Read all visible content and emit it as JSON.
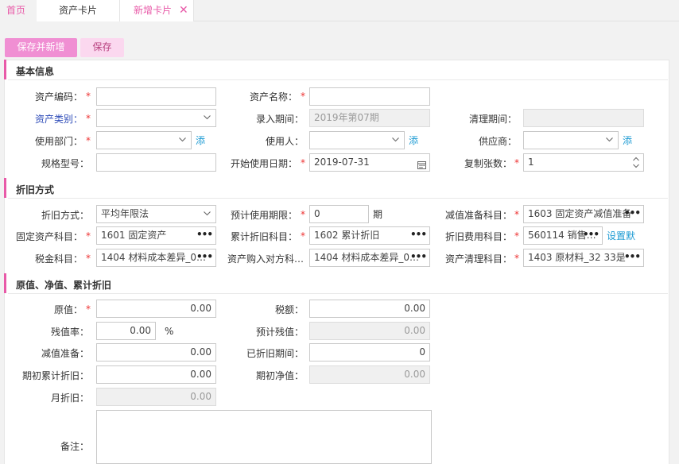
{
  "tabs": {
    "home": "首页",
    "asset_card": "资产卡片",
    "new_card": "新增卡片"
  },
  "toolbar": {
    "save_new_label": "保存并新增",
    "save_label": "保存"
  },
  "sections": {
    "basic": "基本信息",
    "depreciation": "折旧方式",
    "value": "原值、净值、累计折旧"
  },
  "basic": {
    "asset_code_label": "资产编码：",
    "asset_code_value": "",
    "asset_name_label": "资产名称：",
    "asset_name_value": "",
    "asset_category_label": "资产类别：",
    "asset_category_value": "",
    "entry_period_label": "录入期间：",
    "entry_period_value": "2019年第07期",
    "cleanup_period_label": "清理期间：",
    "cleanup_period_value": "",
    "department_label": "使用部门：",
    "department_value": "",
    "department_add": "添",
    "user_label": "使用人：",
    "user_value": "",
    "user_add": "添",
    "supplier_label": "供应商：",
    "supplier_value": "",
    "supplier_add": "添",
    "spec_label": "规格型号：",
    "spec_value": "",
    "start_date_label": "开始使用日期：",
    "start_date_value": "2019-07-31",
    "copy_count_label": "复制张数：",
    "copy_count_value": "1"
  },
  "depreciation": {
    "method_label": "折旧方式：",
    "method_value": "平均年限法",
    "life_label": "预计使用期限：",
    "life_value": "0",
    "life_unit": "期",
    "impairment_account_label": "减值准备科目：",
    "impairment_account_value": "1603 固定资产减值准备",
    "fixed_asset_account_label": "固定资产科目：",
    "fixed_asset_account_value": "1601 固定资产",
    "accum_dep_account_label": "累计折旧科目：",
    "accum_dep_account_value": "1602 累计折旧",
    "dep_expense_account_label": "折旧费用科目：",
    "dep_expense_account_value": "560114 销售…",
    "set_default": "设置默",
    "tax_account_label": "税金科目：",
    "tax_account_value": "1404 材料成本差异_0…",
    "purchase_offset_label": "资产购入对方科…",
    "purchase_offset_value": "1404 材料成本差异_0…",
    "disposal_account_label": "资产清理科目：",
    "disposal_account_value": "1403 原材料_32 33是"
  },
  "value": {
    "original_label": "原值：",
    "original_value": "0.00",
    "tax_label": "税额：",
    "tax_value": "0.00",
    "residual_rate_label": "残值率：",
    "residual_rate_value": "0.00",
    "residual_rate_unit": "%",
    "est_residual_label": "预计残值：",
    "est_residual_value": "0.00",
    "impairment_label": "减值准备：",
    "impairment_value": "0.00",
    "dep_periods_label": "已折旧期间：",
    "dep_periods_value": "0",
    "opening_accum_label": "期初累计折旧：",
    "opening_accum_value": "0.00",
    "opening_net_label": "期初净值：",
    "opening_net_value": "0.00",
    "monthly_dep_label": "月折旧：",
    "monthly_dep_value": "0.00",
    "remark_label": "备注："
  },
  "required_mark": "*",
  "colors": {
    "accent": "#e85aa8",
    "primary_button": "#f08fd3",
    "secondary_button": "#fbd8ef",
    "required": "#ee3333",
    "link": "#1d9bd3",
    "category_label": "#2d4bb8"
  }
}
